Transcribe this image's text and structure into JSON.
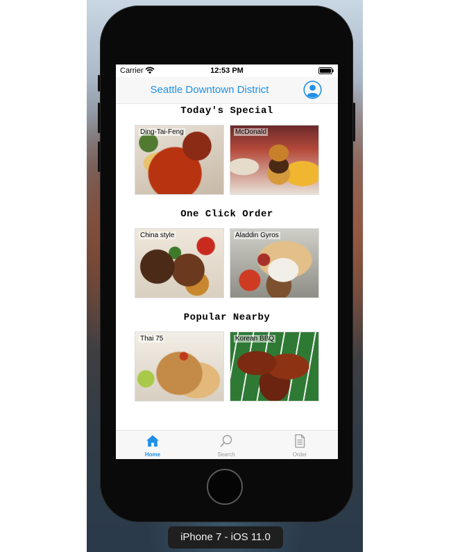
{
  "status_bar": {
    "carrier": "Carrier",
    "time": "12:53 PM"
  },
  "nav": {
    "title": "Seattle Downtown District"
  },
  "sections": [
    {
      "title": "Today's Special",
      "items": [
        {
          "label": "Ding-Tai-Feng"
        },
        {
          "label": "McDonald"
        }
      ]
    },
    {
      "title": "One Click Order",
      "items": [
        {
          "label": "China style"
        },
        {
          "label": "Aladdin Gyros"
        }
      ]
    },
    {
      "title": "Popular Nearby",
      "items": [
        {
          "label": "Thai 75"
        },
        {
          "label": "Korean BBQ"
        }
      ]
    }
  ],
  "tab_bar": {
    "tabs": [
      {
        "label": "Home",
        "icon": "home-icon",
        "active": true
      },
      {
        "label": "Search",
        "icon": "search-icon",
        "active": false
      },
      {
        "label": "Order",
        "icon": "document-icon",
        "active": false
      }
    ]
  },
  "simulator": {
    "device_label": "iPhone 7 - iOS 11.0"
  },
  "colors": {
    "accent": "#1e90e8",
    "inactive_tab": "#9a9a9a"
  }
}
